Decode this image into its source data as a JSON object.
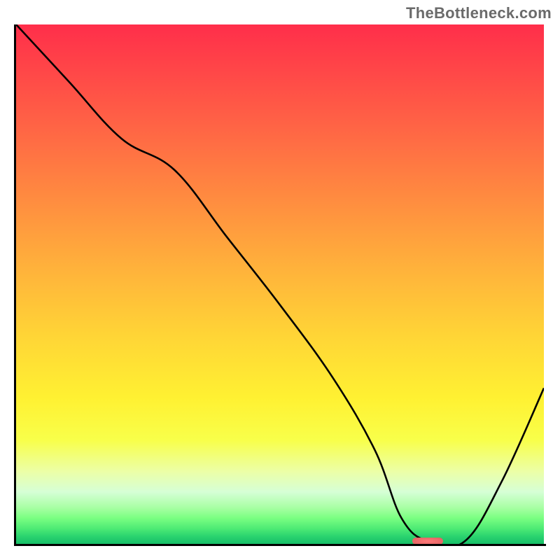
{
  "attribution": "TheBottleneck.com",
  "chart_data": {
    "type": "line",
    "title": "",
    "xlabel": "",
    "ylabel": "",
    "xlim": [
      0,
      100
    ],
    "ylim": [
      0,
      100
    ],
    "x": [
      0,
      10,
      20,
      30,
      40,
      50,
      60,
      68,
      73,
      78,
      85,
      92,
      100
    ],
    "values": [
      100,
      89,
      78,
      72,
      59,
      46,
      32,
      18,
      5,
      0.5,
      0.5,
      12,
      30
    ],
    "optimum_marker": {
      "x": 78,
      "y": 0.5
    },
    "background_gradient": {
      "top": "#ff2e4a",
      "mid": "#fff132",
      "bottom": "#17bf68"
    }
  }
}
